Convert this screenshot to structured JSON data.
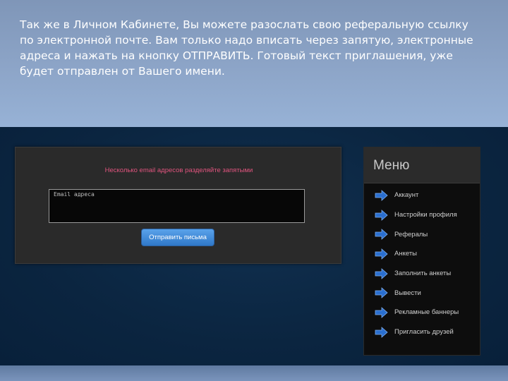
{
  "slide": {
    "text": "Так же в Личном Кабинете, Вы можете разослать свою реферальную ссылку по электронной почте. Вам только надо вписать через запятую, электронные адреса и нажать на кнопку ОТПРАВИТЬ. Готовый текст приглашения, уже будет отправлен от Вашего имени."
  },
  "form": {
    "hint": "Несколько email адресов разделяйте запятыми",
    "email_placeholder": "Email адреса",
    "send_label": "Отправить письма"
  },
  "menu": {
    "title": "Меню",
    "items": [
      {
        "label": "Аккаунт",
        "icon": "arrow-right-icon"
      },
      {
        "label": "Настройки профиля",
        "icon": "arrow-right-icon"
      },
      {
        "label": "Рефералы",
        "icon": "arrow-right-icon"
      },
      {
        "label": "Анкеты",
        "icon": "arrow-right-icon"
      },
      {
        "label": "Заполнить анкеты",
        "icon": "arrow-right-icon"
      },
      {
        "label": "Вывести",
        "icon": "arrow-right-icon"
      },
      {
        "label": "Рекламные баннеры",
        "icon": "arrow-right-icon"
      },
      {
        "label": "Пригласить друзей",
        "icon": "arrow-right-icon"
      }
    ]
  },
  "colors": {
    "accent_blue": "#2f78c8",
    "hint_pink": "#e0547e",
    "arrow_blue": "#2a6fd0"
  }
}
